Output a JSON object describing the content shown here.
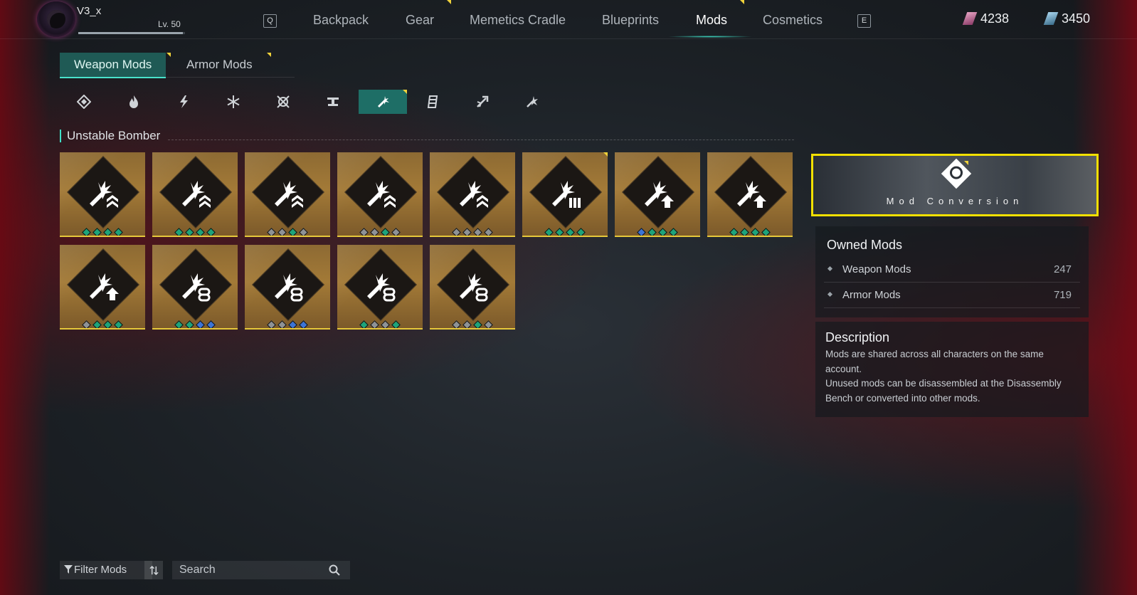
{
  "player": {
    "name": "V3_x",
    "level": "Lv. 50",
    "xp_fraction": 0.98
  },
  "nav": {
    "left_key": "Q",
    "right_key": "E",
    "tabs": [
      "Backpack",
      "Gear",
      "Memetics Cradle",
      "Blueprints",
      "Mods",
      "Cosmetics"
    ],
    "active_tab": "Mods"
  },
  "currencies": [
    {
      "icon": "purple-crystal-icon",
      "amount": "4238",
      "color": "#c86a9b"
    },
    {
      "icon": "blue-crystal-icon",
      "amount": "3450",
      "color": "#6aa5c8"
    }
  ],
  "subtabs": {
    "weapon": "Weapon Mods",
    "armor": "Armor Mods",
    "active": "Weapon Mods"
  },
  "categories": [
    "all-mods-icon",
    "burn-icon",
    "shock-icon",
    "frost-icon",
    "power-surge-icon",
    "turret-icon",
    "unstable-bomber-icon",
    "bullseye-icon",
    "bounce-icon",
    "fast-gunner-icon"
  ],
  "active_category": "unstable-bomber-icon",
  "section": {
    "title": "Unstable Bomber"
  },
  "cards": [
    {
      "badge": "chevron",
      "pips": [
        "green",
        "green",
        "green",
        "green"
      ]
    },
    {
      "badge": "chevron",
      "pips": [
        "green",
        "green",
        "green",
        "green"
      ]
    },
    {
      "badge": "chevron",
      "pips": [
        "gray",
        "gray",
        "green",
        "gray"
      ]
    },
    {
      "badge": "chevron",
      "pips": [
        "gray",
        "gray",
        "green",
        "gray"
      ]
    },
    {
      "badge": "chevron",
      "pips": [
        "gray",
        "gray",
        "gray",
        "gray"
      ]
    },
    {
      "badge": "bullets",
      "pips": [
        "green",
        "green",
        "green",
        "green"
      ],
      "new": true
    },
    {
      "badge": "arrow",
      "pips": [
        "blue",
        "green",
        "green",
        "green"
      ]
    },
    {
      "badge": "arrow",
      "pips": [
        "green",
        "green",
        "green",
        "green"
      ]
    },
    {
      "badge": "arrow",
      "pips": [
        "gray",
        "green",
        "green",
        "green"
      ]
    },
    {
      "badge": "link",
      "pips": [
        "green",
        "green",
        "blue",
        "blue"
      ]
    },
    {
      "badge": "link",
      "pips": [
        "gray",
        "gray",
        "blue",
        "blue"
      ]
    },
    {
      "badge": "link",
      "pips": [
        "green",
        "gray",
        "gray",
        "green"
      ]
    },
    {
      "badge": "link",
      "pips": [
        "gray",
        "gray",
        "green",
        "gray"
      ]
    }
  ],
  "pip_colors": {
    "green": "#1ea37a",
    "gray": "#8e9296",
    "blue": "#3c74d6"
  },
  "conversion": {
    "label": "Mod Conversion"
  },
  "owned": {
    "title": "Owned Mods",
    "rows": [
      {
        "label": "Weapon Mods",
        "value": "247"
      },
      {
        "label": "Armor Mods",
        "value": "719"
      }
    ]
  },
  "description": {
    "title": "Description",
    "lines": [
      "Mods are shared across all characters on the same account.",
      "Unused mods can be disassembled at the Disassembly Bench or converted into other mods."
    ]
  },
  "bottom": {
    "filter_label": "Filter Mods",
    "search_placeholder": "Search"
  }
}
